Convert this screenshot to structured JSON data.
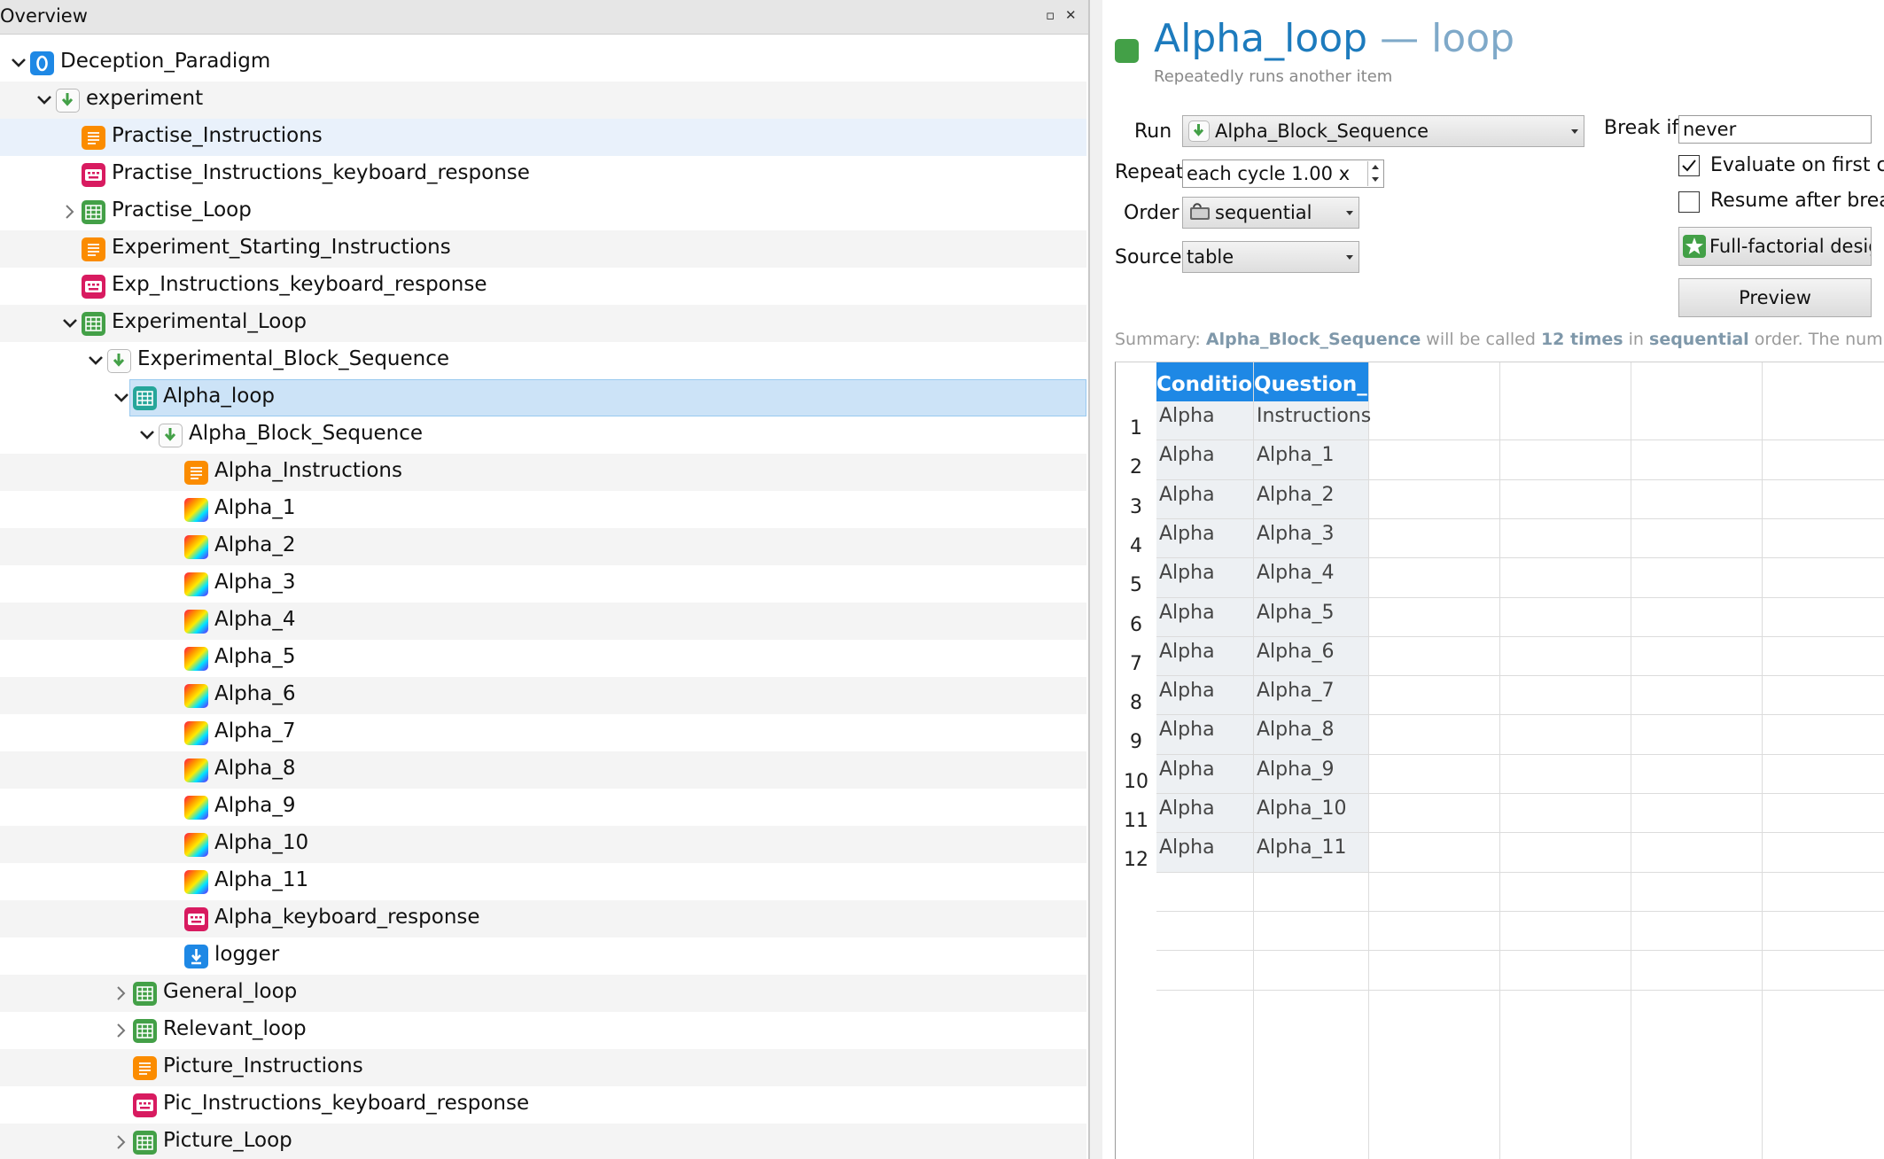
{
  "overview": {
    "title": "Overview",
    "float_glyph": "▫",
    "close_glyph": "✕",
    "tree": [
      {
        "label": "Deception_Paradigm",
        "depth": 0,
        "icon": "experiment-icon",
        "expander": "open",
        "bg": "white"
      },
      {
        "label": "experiment",
        "depth": 1,
        "icon": "sequence-icon",
        "expander": "open",
        "bg": "alt"
      },
      {
        "label": "Practise_Instructions",
        "depth": 2,
        "icon": "form-text-icon",
        "expander": "none",
        "bg": "hover"
      },
      {
        "label": "Practise_Instructions_keyboard_response",
        "depth": 2,
        "icon": "keyboard-response-icon",
        "expander": "none",
        "bg": "white"
      },
      {
        "label": "Practise_Loop",
        "depth": 2,
        "icon": "loop-icon",
        "expander": "closed",
        "bg": "white"
      },
      {
        "label": "Experiment_Starting_Instructions",
        "depth": 2,
        "icon": "form-text-icon",
        "expander": "none",
        "bg": "alt"
      },
      {
        "label": "Exp_Instructions_keyboard_response",
        "depth": 2,
        "icon": "keyboard-response-icon",
        "expander": "none",
        "bg": "white"
      },
      {
        "label": "Experimental_Loop",
        "depth": 2,
        "icon": "loop-icon",
        "expander": "open",
        "bg": "alt"
      },
      {
        "label": "Experimental_Block_Sequence",
        "depth": 3,
        "icon": "sequence-icon",
        "expander": "open",
        "bg": "white"
      },
      {
        "label": "Alpha_loop",
        "depth": 4,
        "icon": "loop-icon",
        "expander": "open",
        "bg": "selected"
      },
      {
        "label": "Alpha_Block_Sequence",
        "depth": 5,
        "icon": "sequence-icon",
        "expander": "open",
        "bg": "white"
      },
      {
        "label": "Alpha_Instructions",
        "depth": 6,
        "icon": "form-text-icon",
        "expander": "none",
        "bg": "alt"
      },
      {
        "label": "Alpha_1",
        "depth": 6,
        "icon": "sketchpad-icon",
        "expander": "none",
        "bg": "white"
      },
      {
        "label": "Alpha_2",
        "depth": 6,
        "icon": "sketchpad-icon",
        "expander": "none",
        "bg": "alt"
      },
      {
        "label": "Alpha_3",
        "depth": 6,
        "icon": "sketchpad-icon",
        "expander": "none",
        "bg": "white"
      },
      {
        "label": "Alpha_4",
        "depth": 6,
        "icon": "sketchpad-icon",
        "expander": "none",
        "bg": "alt"
      },
      {
        "label": "Alpha_5",
        "depth": 6,
        "icon": "sketchpad-icon",
        "expander": "none",
        "bg": "white"
      },
      {
        "label": "Alpha_6",
        "depth": 6,
        "icon": "sketchpad-icon",
        "expander": "none",
        "bg": "alt"
      },
      {
        "label": "Alpha_7",
        "depth": 6,
        "icon": "sketchpad-icon",
        "expander": "none",
        "bg": "white"
      },
      {
        "label": "Alpha_8",
        "depth": 6,
        "icon": "sketchpad-icon",
        "expander": "none",
        "bg": "alt"
      },
      {
        "label": "Alpha_9",
        "depth": 6,
        "icon": "sketchpad-icon",
        "expander": "none",
        "bg": "white"
      },
      {
        "label": "Alpha_10",
        "depth": 6,
        "icon": "sketchpad-icon",
        "expander": "none",
        "bg": "alt"
      },
      {
        "label": "Alpha_11",
        "depth": 6,
        "icon": "sketchpad-icon",
        "expander": "none",
        "bg": "white"
      },
      {
        "label": "Alpha_keyboard_response",
        "depth": 6,
        "icon": "keyboard-response-icon",
        "expander": "none",
        "bg": "alt"
      },
      {
        "label": "logger",
        "depth": 6,
        "icon": "logger-icon",
        "expander": "none",
        "bg": "white"
      },
      {
        "label": "General_loop",
        "depth": 4,
        "icon": "loop-icon",
        "expander": "closed",
        "bg": "alt"
      },
      {
        "label": "Relevant_loop",
        "depth": 4,
        "icon": "loop-icon",
        "expander": "closed",
        "bg": "white"
      },
      {
        "label": "Picture_Instructions",
        "depth": 4,
        "icon": "form-text-icon",
        "expander": "none",
        "bg": "alt"
      },
      {
        "label": "Pic_Instructions_keyboard_response",
        "depth": 4,
        "icon": "keyboard-response-icon",
        "expander": "none",
        "bg": "white"
      },
      {
        "label": "Picture_Loop",
        "depth": 4,
        "icon": "loop-icon",
        "expander": "closed",
        "bg": "alt"
      }
    ]
  },
  "editor": {
    "title_name": "Alpha_loop",
    "title_type": " — loop",
    "subtitle": "Repeatedly runs another item",
    "run_label": "Run",
    "run_value": "Alpha_Block_Sequence",
    "break_label": "Break if",
    "break_value": "never",
    "repeat_label": "Repeat",
    "repeat_value": "each cycle 1.00 x",
    "order_label": "Order",
    "order_value": "sequential",
    "source_label": "Source",
    "source_value": "table",
    "evaluate_first_label": "Evaluate on first cy",
    "evaluate_first_checked": true,
    "resume_break_label": "Resume after break",
    "resume_break_checked": false,
    "full_factorial_label": "Full-factorial design",
    "preview_label": "Preview",
    "summary": {
      "prefix": "Summary: ",
      "item": "Alpha_Block_Sequence",
      "mid1": " will be called ",
      "count": "12 times",
      "mid2": " in ",
      "order": "sequential",
      "suffix": " order. The number of rows is"
    },
    "table": {
      "columns": [
        "Condition",
        "Question_ID"
      ],
      "rows": [
        [
          "Alpha",
          "Instructions"
        ],
        [
          "Alpha",
          "Alpha_1"
        ],
        [
          "Alpha",
          "Alpha_2"
        ],
        [
          "Alpha",
          "Alpha_3"
        ],
        [
          "Alpha",
          "Alpha_4"
        ],
        [
          "Alpha",
          "Alpha_5"
        ],
        [
          "Alpha",
          "Alpha_6"
        ],
        [
          "Alpha",
          "Alpha_7"
        ],
        [
          "Alpha",
          "Alpha_8"
        ],
        [
          "Alpha",
          "Alpha_9"
        ],
        [
          "Alpha",
          "Alpha_10"
        ],
        [
          "Alpha",
          "Alpha_11"
        ]
      ]
    }
  },
  "colors": {
    "accent_blue": "#1e88e5",
    "title_blue": "#1d7bbd",
    "selection": "#cce3f7",
    "loop_green": "#43a047",
    "form_orange": "#fb8c00",
    "keyboard_pink": "#d81b60"
  }
}
